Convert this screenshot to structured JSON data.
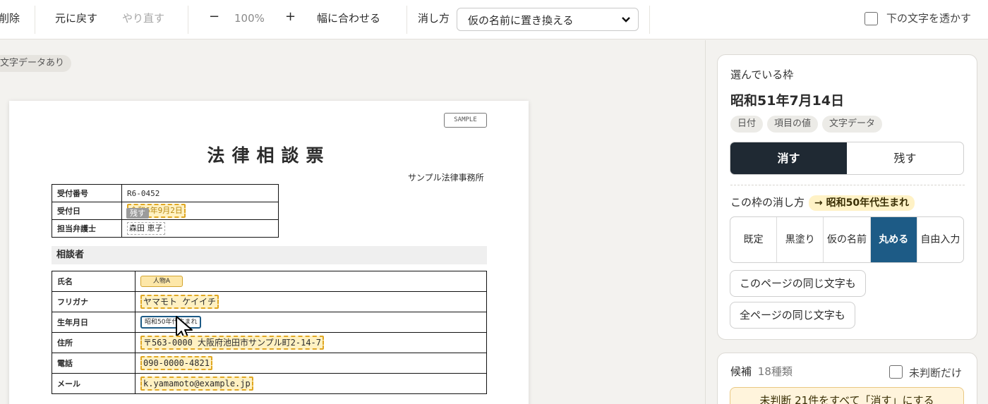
{
  "toolbar": {
    "delete_label": "削除",
    "undo_label": "元に戻す",
    "redo_label": "やり直す",
    "zoom_out": "−",
    "zoom_level": "100%",
    "zoom_in": "+",
    "fit_width_label": "幅に合わせる",
    "method_label": "消し方",
    "method_value": "仮の名前に置き換える",
    "show_text_label": "下の文字を透かす"
  },
  "canvas": {
    "text_data_pill": "文字データあり"
  },
  "document": {
    "sample_stamp": "SAMPLE",
    "title": "法律相談票",
    "office": "サンプル法律事務所",
    "reception": [
      {
        "key": "受付番号",
        "value": "R6-0452"
      },
      {
        "key": "受付日",
        "value": "令和6年9月2日"
      },
      {
        "key": "担当弁護士",
        "value": "森田 恵子"
      }
    ],
    "remain_badge": "残す",
    "section_title": "相談者",
    "client": {
      "name_key": "氏名",
      "name_value": "人物A",
      "kana_key": "フリガナ",
      "kana_value": "ヤマモト ケイイチ",
      "dob_key": "生年月日",
      "dob_value": "昭和50年代生まれ",
      "address_key": "住所",
      "address_value": "〒563-0000 大阪府池田市サンプル町2-14-7",
      "phone_key": "電話",
      "phone_value": "090-0000-4821",
      "mail_key": "メール",
      "mail_value": "k.yamamoto@example.jp"
    }
  },
  "panel": {
    "selected_label": "選んでいる枠",
    "selected_value": "昭和51年7月14日",
    "chips": [
      "日付",
      "項目の値",
      "文字データ"
    ],
    "erase_label": "消す",
    "keep_label": "残す",
    "method_label": "この枠の消し方",
    "method_result": "→ 昭和50年代生まれ",
    "methods": [
      "既定",
      "黒塗り",
      "仮の名前",
      "丸める",
      "自由入力"
    ],
    "same_page_label": "このページの同じ文字も",
    "all_pages_label": "全ページの同じ文字も",
    "candidates_label": "候補",
    "candidates_count": "18種類",
    "unjudged_only_label": "未判断だけ",
    "bulk_erase_label": "未判断 21件をすべて「消す」にする"
  },
  "colors": {
    "accent_dark": "#1f2933",
    "accent_blue": "#1d5b86",
    "highlight": "#fff1c2"
  }
}
